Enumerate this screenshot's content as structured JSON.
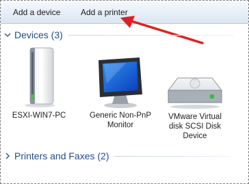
{
  "toolbar": {
    "add_device_label": "Add a device",
    "add_printer_label": "Add a printer"
  },
  "devices_group": {
    "label": "Devices (3)",
    "items": [
      {
        "name": "ESXI-WIN7-PC",
        "icon": "computer-tower-icon"
      },
      {
        "name": "Generic Non-PnP\nMonitor",
        "icon": "monitor-icon"
      },
      {
        "name": "VMware Virtual\ndisk SCSI Disk\nDevice",
        "icon": "hard-disk-icon"
      }
    ]
  },
  "printers_group": {
    "label": "Printers and Faxes (2)"
  },
  "colors": {
    "group_header": "#1e4c8c",
    "annotation_arrow": "#e02020",
    "toolbar_top": "#f6f9fd",
    "toolbar_bottom": "#dbe6f3"
  }
}
